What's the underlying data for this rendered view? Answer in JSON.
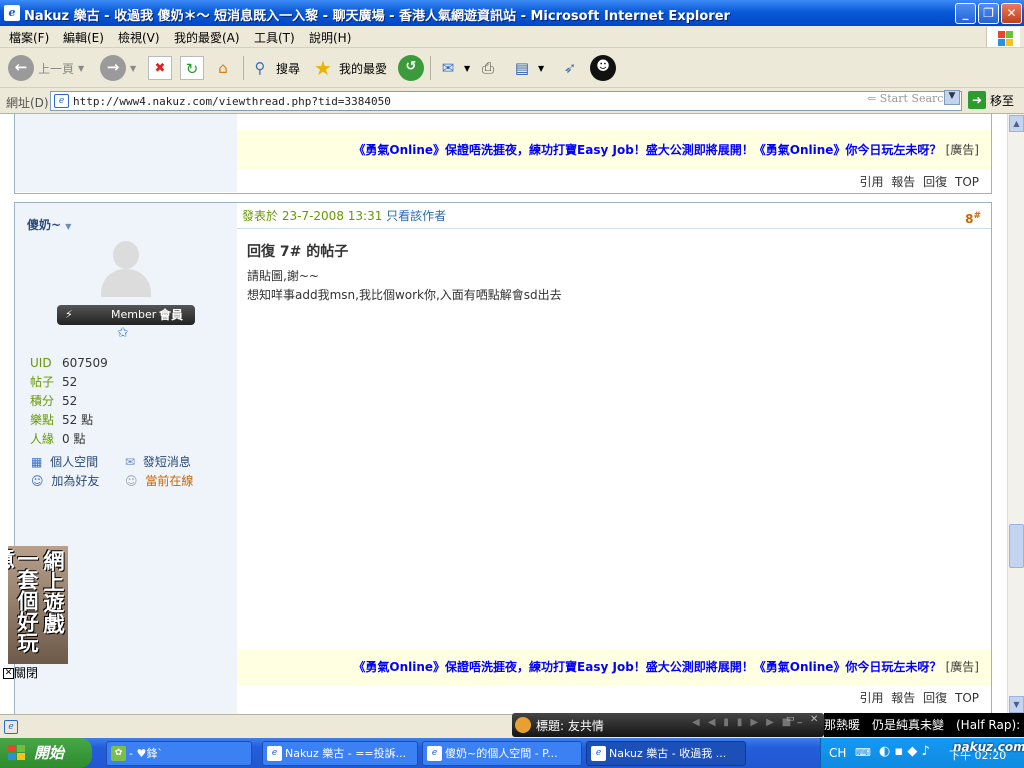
{
  "window": {
    "title": "Nakuz 樂古 - 收過我 傻奶＊～ 短消息既入一入黎 - 聊天廣場 - 香港人氣網遊資訊站 - Microsoft Internet Explorer"
  },
  "menu": [
    "檔案(F)",
    "編輯(E)",
    "檢視(V)",
    "我的最愛(A)",
    "工具(T)",
    "說明(H)"
  ],
  "toolbar": {
    "back": "上一頁",
    "search": "搜尋",
    "favorites": "我的最愛"
  },
  "address": {
    "label": "網址(D)",
    "url": "http://www4.nakuz.com/viewthread.php?tid=3384050",
    "start_search": "Start Search",
    "go": "移至"
  },
  "ad": {
    "text": "《勇氣Online》保證唔洗捱夜，練功打寶Easy Job！盛大公測即將展開！《勇氣Online》你今日玩左未呀？",
    "tag": "[廣告]"
  },
  "post_actions": [
    "引用",
    "報告",
    "回復",
    "TOP"
  ],
  "user": {
    "name": "傻奶~",
    "member_label": "Member",
    "member_rank": "會員",
    "stats": [
      {
        "label": "UID",
        "value": "607509"
      },
      {
        "label": "帖子",
        "value": "52"
      },
      {
        "label": "積分",
        "value": "52"
      },
      {
        "label": "樂點",
        "value": "52 點"
      },
      {
        "label": "人緣",
        "value": "0 點"
      }
    ],
    "links": {
      "space": "個人空間",
      "pm": "發短消息",
      "add_friend": "加為好友",
      "online": "當前在線"
    }
  },
  "post": {
    "posted_label": "發表於",
    "date": "23-7-2008 13:31",
    "only_author": "只看該作者",
    "floor": "8",
    "floor_mark": "#",
    "title": "回復 7# 的帖子",
    "lines": [
      "請貼圖,謝~~",
      "想知咩事add我msn,我比個work你,入面有哂點解會sd出去"
    ]
  },
  "side_ad": {
    "text_right": "網上遊戲",
    "text_left": "一套個好玩意",
    "close": "關閉"
  },
  "media": {
    "title": "標題: 友共情"
  },
  "ticker": "那熱暖　仍是純真未變　(Half Rap): N",
  "taskbar": {
    "start": "開始",
    "tasks": [
      "- ♥鋒`",
      "Nakuz 樂古 - ==投訴...",
      "傻奶~的個人空間 - P...",
      "Nakuz 樂古 - 收過我 ..."
    ],
    "lang": "CH",
    "time": "下午 02:20",
    "watermark": "nakuz.com"
  },
  "colors": {
    "accent_green": "#669900",
    "link_blue": "#0000ff",
    "floor_orange": "#cc6600",
    "ad_bg": "#ffffe1",
    "sidebar_bg": "#eef4fa"
  }
}
